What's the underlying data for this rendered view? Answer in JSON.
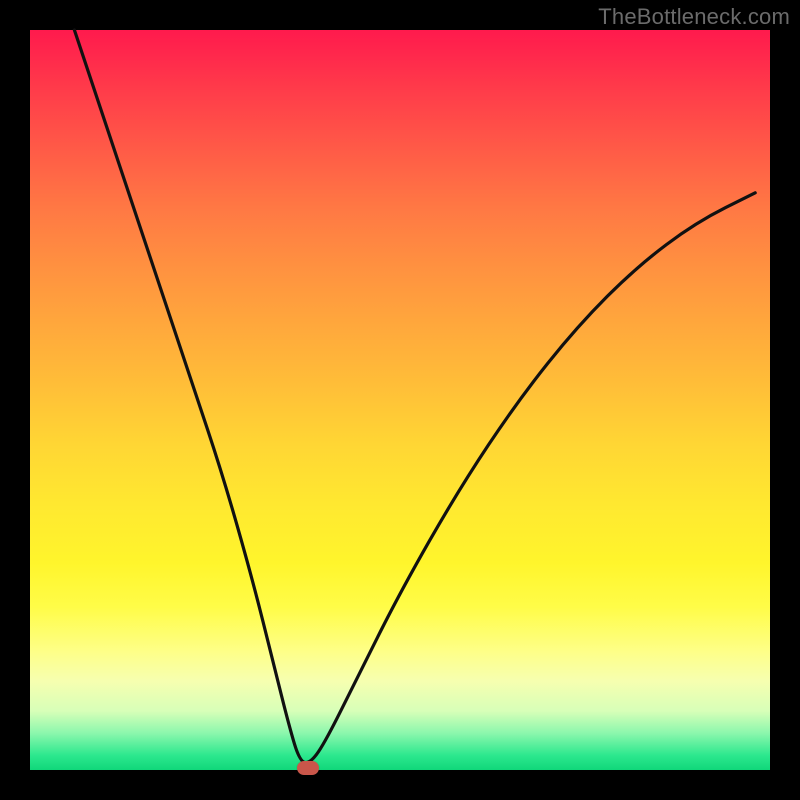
{
  "watermark": "TheBottleneck.com",
  "colors": {
    "frame": "#000000",
    "curve_stroke": "#111111",
    "marker_fill": "#c9564a",
    "gradient_top": "#ff1a4d",
    "gradient_bottom": "#10d77a"
  },
  "chart_data": {
    "type": "line",
    "title": "",
    "xlabel": "",
    "ylabel": "",
    "xlim": [
      0,
      100
    ],
    "ylim": [
      0,
      100
    ],
    "note": "Background is a vertical gradient (red→orange→yellow→green). A single black V-shaped curve plunges from the top-left and top-right toward a minimum near x≈37, y≈0, with a small rounded-rect marker at the bottom of the valley.",
    "series": [
      {
        "name": "curve",
        "x": [
          6,
          10,
          14,
          18,
          22,
          26,
          30,
          33,
          35,
          36.5,
          38,
          40,
          44,
          50,
          58,
          66,
          74,
          82,
          90,
          98
        ],
        "y": [
          100,
          88,
          76,
          64,
          52,
          40,
          26,
          14,
          6,
          1,
          1,
          4,
          12,
          24,
          38,
          50,
          60,
          68,
          74,
          78
        ]
      }
    ],
    "marker": {
      "x": 37.5,
      "y": 0
    }
  }
}
